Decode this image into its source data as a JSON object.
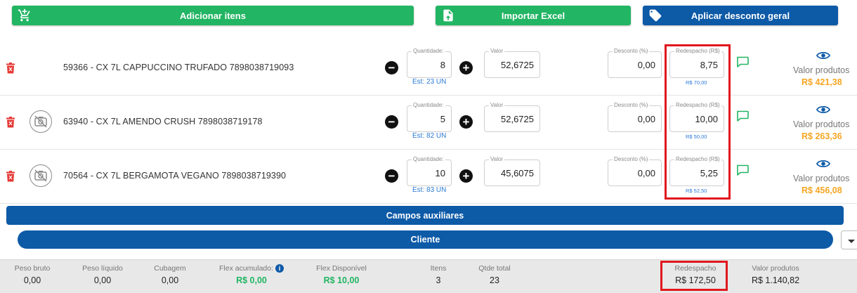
{
  "toolbar": {
    "add_items": "Adicionar itens",
    "import_excel": "Importar Excel",
    "apply_discount": "Aplicar desconto geral"
  },
  "labels": {
    "quantity": "Quantidade:",
    "value": "Valor",
    "discount": "Desconto (%)",
    "redespacho": "Redespacho (R$)",
    "valor_produtos": "Valor produtos"
  },
  "items": [
    {
      "name": "59366 - CX 7L CAPPUCCINO TRUFADO 7898038719093",
      "qty": "8",
      "stock": "Est: 23 UN",
      "value": "52,6725",
      "discount": "0,00",
      "redespacho": "8,75",
      "redespacho_total": "R$ 70,00",
      "total": "R$ 421,38",
      "has_image_placeholder": false
    },
    {
      "name": "63940 - CX 7L AMENDO CRUSH 7898038719178",
      "qty": "5",
      "stock": "Est: 82 UN",
      "value": "52,6725",
      "discount": "0,00",
      "redespacho": "10,00",
      "redespacho_total": "R$ 50,00",
      "total": "R$ 263,36",
      "has_image_placeholder": true
    },
    {
      "name": "70564 - CX 7L BERGAMOTA VEGANO 7898038719390",
      "qty": "10",
      "stock": "Est: 83 UN",
      "value": "45,6075",
      "discount": "0,00",
      "redespacho": "5,25",
      "redespacho_total": "R$ 52,50",
      "total": "R$ 456,08",
      "has_image_placeholder": true
    }
  ],
  "sections": {
    "aux": "Campos auxiliares",
    "client": "Cliente"
  },
  "footer": {
    "peso_bruto": {
      "label": "Peso bruto",
      "value": "0,00"
    },
    "peso_liquido": {
      "label": "Peso líquido",
      "value": "0,00"
    },
    "cubagem": {
      "label": "Cubagem",
      "value": "0,00"
    },
    "flex_acumulado": {
      "label": "Flex acumulado:",
      "value": "R$ 0,00"
    },
    "flex_disponivel": {
      "label": "Flex Disponível",
      "value": "R$ 10,00"
    },
    "itens": {
      "label": "Itens",
      "value": "3"
    },
    "qtde_total": {
      "label": "Qtde total",
      "value": "23"
    },
    "redespacho": {
      "label": "Redespacho",
      "value": "R$ 172,50"
    },
    "valor_produtos": {
      "label": "Valor produtos",
      "value": "R$ 1.140,82"
    }
  },
  "colors": {
    "green": "#22b563",
    "blue": "#0d5aa7",
    "orange": "#f6a623",
    "red_highlight": "#e0181e",
    "trash_red": "#e53935"
  },
  "icons": [
    "cart-add-icon",
    "file-upload-icon",
    "tag-icon",
    "trash-icon",
    "no-image-icon",
    "minus-icon",
    "plus-icon",
    "chat-icon",
    "eye-icon",
    "info-icon",
    "chevron-down-icon"
  ]
}
